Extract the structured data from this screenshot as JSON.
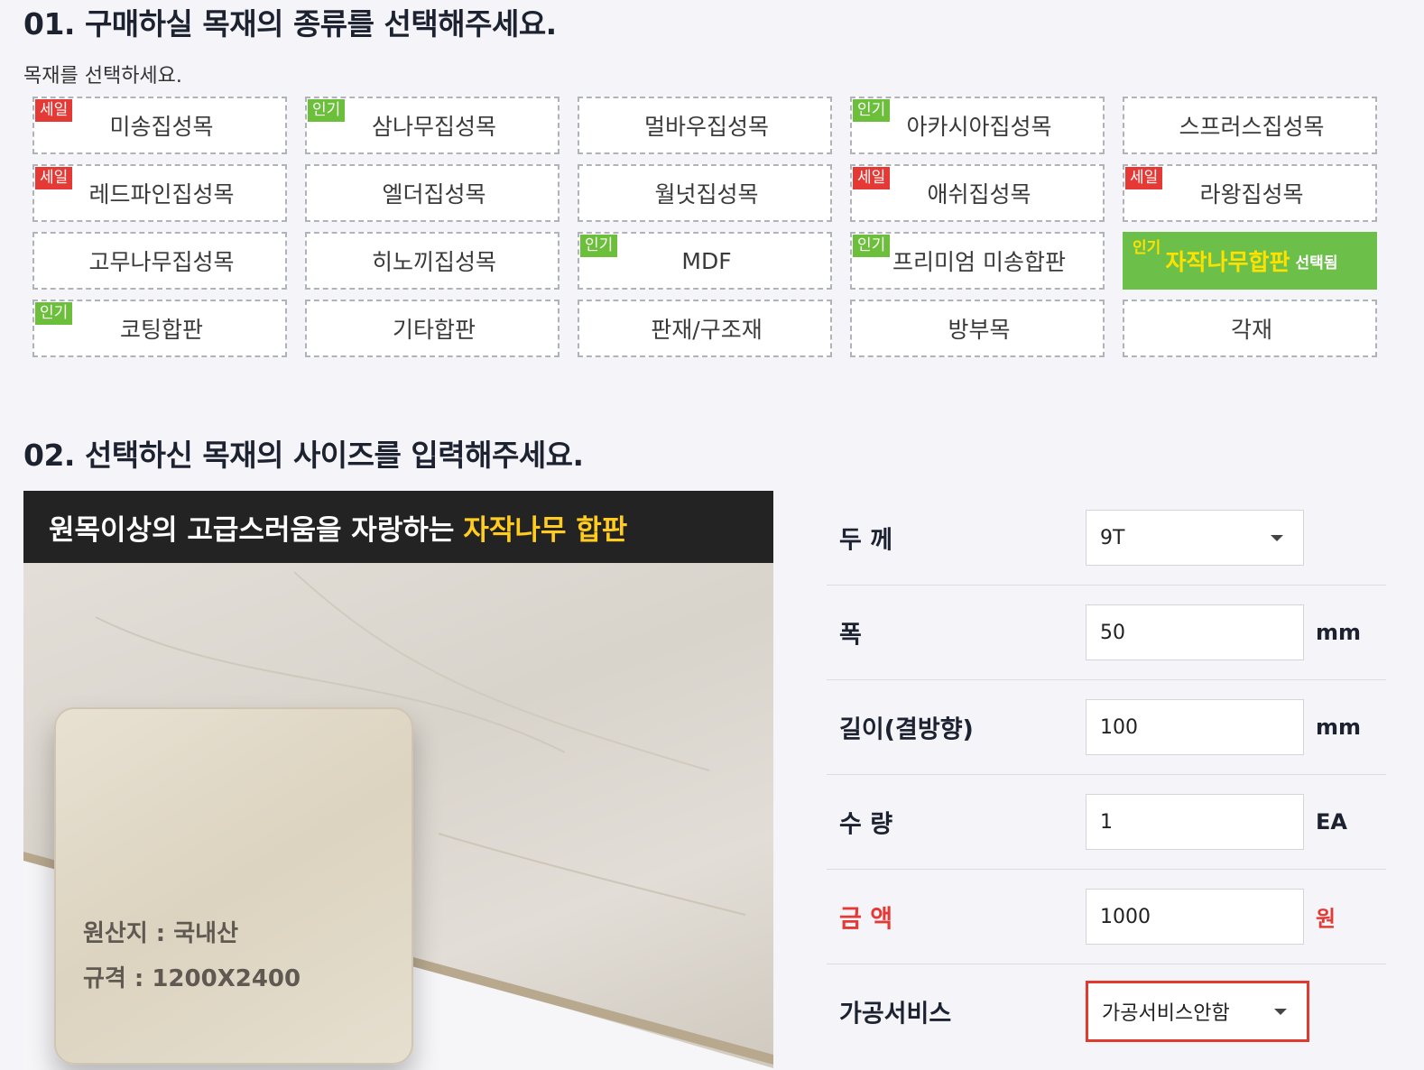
{
  "section1": {
    "title": "01. 구매하실 목재의 종류를 선택해주세요.",
    "subtitle": "목재를 선택하세요."
  },
  "wood_types": [
    {
      "label": "미송집성목",
      "badge": "세일"
    },
    {
      "label": "삼나무집성목",
      "badge": "인기"
    },
    {
      "label": "멀바우집성목",
      "badge": ""
    },
    {
      "label": "아카시아집성목",
      "badge": "인기"
    },
    {
      "label": "스프러스집성목",
      "badge": ""
    },
    {
      "label": "레드파인집성목",
      "badge": "세일"
    },
    {
      "label": "엘더집성목",
      "badge": ""
    },
    {
      "label": "월넛집성목",
      "badge": ""
    },
    {
      "label": "애쉬집성목",
      "badge": "세일"
    },
    {
      "label": "라왕집성목",
      "badge": "세일"
    },
    {
      "label": "고무나무집성목",
      "badge": ""
    },
    {
      "label": "히노끼집성목",
      "badge": ""
    },
    {
      "label": "MDF",
      "badge": "인기"
    },
    {
      "label": "프리미엄 미송합판",
      "badge": "인기"
    },
    {
      "label": "자작나무합판",
      "badge": "인기",
      "selected_tag": "선택됨"
    },
    {
      "label": "코팅합판",
      "badge": "인기"
    },
    {
      "label": "기타합판",
      "badge": ""
    },
    {
      "label": "판재/구조재",
      "badge": ""
    },
    {
      "label": "방부목",
      "badge": ""
    },
    {
      "label": "각재",
      "badge": ""
    }
  ],
  "section2": {
    "title": "02. 선택하신 목재의 사이즈를 입력해주세요."
  },
  "promo": {
    "banner_text": "원목이상의 고급스러움을 자랑하는",
    "banner_highlight": "자작나무 합판",
    "origin": "원산지 : 국내산",
    "spec": "규격 : 1200X2400"
  },
  "form": {
    "thickness": {
      "label": "두 께",
      "value": "9T"
    },
    "width": {
      "label": "폭",
      "value": "50",
      "unit": "mm"
    },
    "length": {
      "label": "길이(결방향)",
      "value": "100",
      "unit": "mm"
    },
    "quantity": {
      "label": "수 량",
      "value": "1",
      "unit": "EA"
    },
    "price": {
      "label": "금 액",
      "value": "1000",
      "unit": "원"
    },
    "service": {
      "label": "가공서비스",
      "value": "가공서비스안함"
    }
  },
  "colors": {
    "sale_badge": "#e53935",
    "popular_badge": "#6cbf3a",
    "selected_bg": "#6cc049",
    "selected_text": "#ffe100",
    "price_label": "#e53935",
    "service_border": "#e03a2f"
  }
}
